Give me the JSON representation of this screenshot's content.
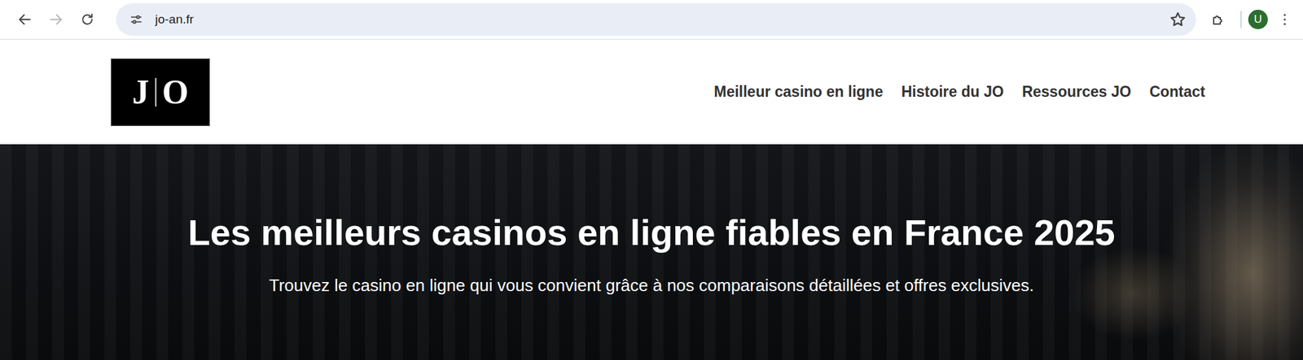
{
  "browser": {
    "url": "jo-an.fr",
    "forward_enabled": false,
    "bookmarked": false,
    "profile_initial": "U"
  },
  "site": {
    "logo": {
      "left": "J",
      "right": "O"
    },
    "nav": [
      {
        "label": "Meilleur casino en ligne"
      },
      {
        "label": "Histoire du JO"
      },
      {
        "label": "Ressources JO"
      },
      {
        "label": "Contact"
      }
    ],
    "hero": {
      "title": "Les meilleurs casinos en ligne fiables en France 2025",
      "subtitle": "Trouvez le casino en ligne qui vous convient grâce à nos comparaisons détaillées et offres exclusives."
    }
  }
}
